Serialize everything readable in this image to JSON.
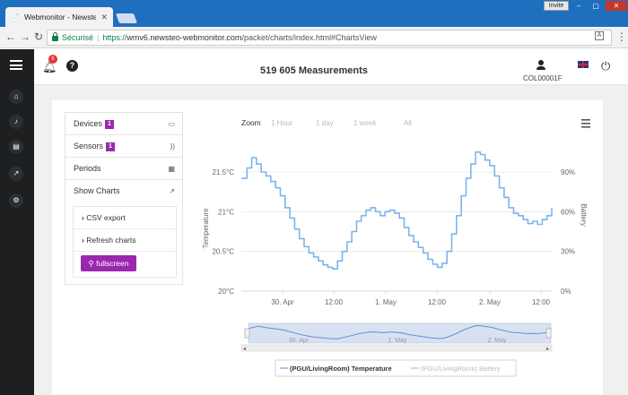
{
  "browser": {
    "tab_title": "Webmonitor - Newsteo",
    "invite_label": "Invite",
    "secure_label": "Sécurisé",
    "url_scheme": "https://",
    "url_host": "wmv6.newsteo-webmonitor.com",
    "url_path": "/packet/charts/index.html#ChartsView"
  },
  "header": {
    "notification_count": "6",
    "measurements": "519 605 Measurements",
    "user_id": "COL00001F"
  },
  "sidebar": {
    "items": [
      {
        "icon": "home-icon"
      },
      {
        "icon": "bell-icon"
      },
      {
        "icon": "stack-icon"
      },
      {
        "icon": "chart-icon"
      },
      {
        "icon": "gear-icon"
      }
    ]
  },
  "menu": {
    "items": [
      {
        "label": "Devices",
        "count": "1",
        "icon": "device-icon"
      },
      {
        "label": "Sensors",
        "count": "1",
        "icon": "rss-icon"
      },
      {
        "label": "Periods",
        "icon": "calendar-icon"
      },
      {
        "label": "Show Charts",
        "icon": "trend-icon"
      }
    ],
    "actions": [
      {
        "label": "CSV export"
      },
      {
        "label": "Refresh charts"
      }
    ],
    "fullscreen_label": "fullscreen"
  },
  "chart_data": {
    "type": "line",
    "zoom_label": "Zoom",
    "zoom_options": [
      "1 Hour",
      "1 day",
      "1 week",
      "All"
    ],
    "ylabel": "Temperature",
    "y2label": "Battery",
    "ylim": [
      20,
      21.5
    ],
    "y_ticks": [
      "20°C",
      "20.5°C",
      "21°C",
      "21.5°C"
    ],
    "y2_ticks": [
      "0%",
      "30%",
      "60%",
      "90%"
    ],
    "x_ticks": [
      "30. Apr",
      "12:00",
      "1. May",
      "12:00",
      "2. May",
      "12:00"
    ],
    "navigator_ticks": [
      "30. Apr",
      "1. May",
      "2. May"
    ],
    "series": [
      {
        "name": "(PGU/LivingRoom) Temperature",
        "color": "#7cb5ec",
        "values": [
          21.42,
          21.55,
          21.68,
          21.6,
          21.5,
          21.45,
          21.38,
          21.3,
          21.2,
          21.05,
          20.92,
          20.78,
          20.66,
          20.56,
          20.48,
          20.43,
          20.38,
          20.33,
          20.3,
          20.28,
          20.38,
          20.5,
          20.62,
          20.75,
          20.88,
          20.95,
          21.02,
          21.05,
          21.0,
          20.95,
          21.0,
          21.02,
          20.98,
          20.92,
          20.8,
          20.7,
          20.62,
          20.55,
          20.48,
          20.4,
          20.34,
          20.3,
          20.35,
          20.5,
          20.72,
          20.95,
          21.2,
          21.42,
          21.6,
          21.75,
          21.72,
          21.65,
          21.58,
          21.45,
          21.3,
          21.18,
          21.05,
          20.98,
          20.95,
          20.9,
          20.85,
          20.88,
          20.84,
          20.9,
          20.95,
          21.05
        ]
      },
      {
        "name": "(PGU/LivingRoom) Battery",
        "color": "#cccccc",
        "values": []
      }
    ]
  }
}
